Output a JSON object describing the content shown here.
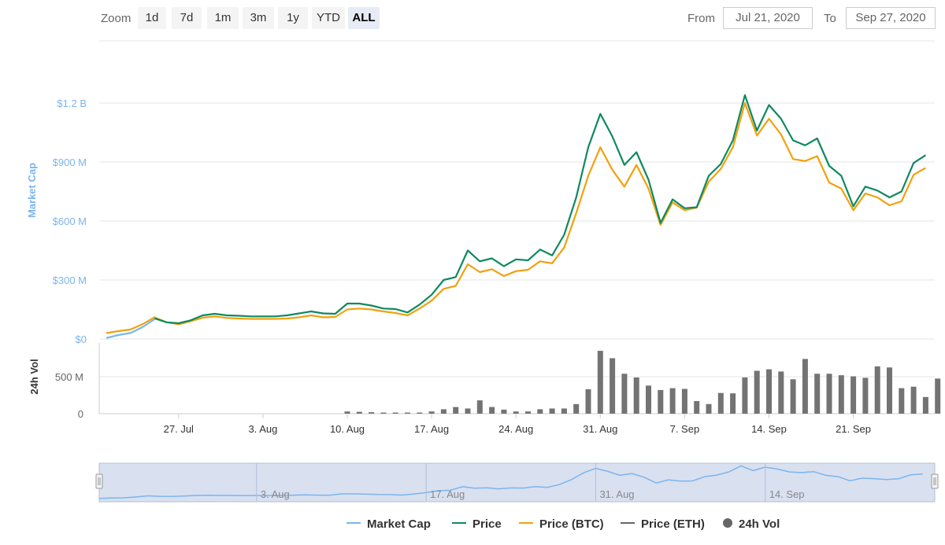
{
  "toolbar": {
    "zoom_label": "Zoom",
    "zoom_buttons": [
      "1d",
      "7d",
      "1m",
      "3m",
      "1y",
      "YTD",
      "ALL"
    ],
    "active_zoom": "ALL",
    "from_label": "From",
    "from_value": "Jul 21, 2020",
    "to_label": "To",
    "to_value": "Sep 27, 2020"
  },
  "colors": {
    "market_cap": "#7cb5ec",
    "price": "#0e8a5f",
    "price_btc": "#f1a10d",
    "price_eth": "#666666",
    "volume": "#737373",
    "navigator_fill": "#ccd6eb",
    "axis_blue": "#7cb5ec"
  },
  "chart_data": {
    "type": "line",
    "x_dates": [
      "2020-07-21",
      "2020-07-22",
      "2020-07-23",
      "2020-07-24",
      "2020-07-25",
      "2020-07-26",
      "2020-07-27",
      "2020-07-28",
      "2020-07-29",
      "2020-07-30",
      "2020-07-31",
      "2020-08-01",
      "2020-08-02",
      "2020-08-03",
      "2020-08-04",
      "2020-08-05",
      "2020-08-06",
      "2020-08-07",
      "2020-08-08",
      "2020-08-09",
      "2020-08-10",
      "2020-08-11",
      "2020-08-12",
      "2020-08-13",
      "2020-08-14",
      "2020-08-15",
      "2020-08-16",
      "2020-08-17",
      "2020-08-18",
      "2020-08-19",
      "2020-08-20",
      "2020-08-21",
      "2020-08-22",
      "2020-08-23",
      "2020-08-24",
      "2020-08-25",
      "2020-08-26",
      "2020-08-27",
      "2020-08-28",
      "2020-08-29",
      "2020-08-30",
      "2020-08-31",
      "2020-09-01",
      "2020-09-02",
      "2020-09-03",
      "2020-09-04",
      "2020-09-05",
      "2020-09-06",
      "2020-09-07",
      "2020-09-08",
      "2020-09-09",
      "2020-09-10",
      "2020-09-11",
      "2020-09-12",
      "2020-09-13",
      "2020-09-14",
      "2020-09-15",
      "2020-09-16",
      "2020-09-17",
      "2020-09-18",
      "2020-09-19",
      "2020-09-20",
      "2020-09-21",
      "2020-09-22",
      "2020-09-23",
      "2020-09-24",
      "2020-09-25",
      "2020-09-26",
      "2020-09-27",
      "2020-09-28"
    ],
    "x_ticks": [
      "27. Jul",
      "3. Aug",
      "10. Aug",
      "17. Aug",
      "24. Aug",
      "31. Aug",
      "7. Sep",
      "14. Sep",
      "21. Sep"
    ],
    "ylabel": "Market Cap",
    "y_ticks": [
      "$0",
      "$300 M",
      "$600 M",
      "$900 M",
      "$1.2 B"
    ],
    "ylim": [
      0,
      1200
    ],
    "y_unit": "M USD",
    "series": [
      {
        "name": "Market Cap",
        "color": "#7cb5ec",
        "start_index": 0,
        "values": [
          5,
          20,
          30,
          60,
          100
        ]
      },
      {
        "name": "Price",
        "color": "#0e8a5f",
        "start_index": 4,
        "values": [
          105,
          85,
          80,
          95,
          120,
          128,
          120,
          118,
          115,
          115,
          115,
          120,
          130,
          140,
          130,
          128,
          180,
          180,
          170,
          155,
          152,
          135,
          175,
          225,
          300,
          315,
          450,
          395,
          410,
          370,
          405,
          400,
          455,
          425,
          530,
          720,
          975,
          1145,
          1030,
          885,
          950,
          810,
          590,
          710,
          665,
          670,
          830,
          890,
          1010,
          1240,
          1060,
          1190,
          1120,
          1010,
          985,
          1020,
          880,
          830,
          675,
          775,
          755,
          720,
          750,
          895,
          935
        ]
      },
      {
        "name": "Price (BTC)",
        "color": "#f1a10d",
        "start_index": 0,
        "values": [
          30,
          40,
          48,
          75,
          110,
          85,
          75,
          90,
          108,
          115,
          107,
          104,
          102,
          102,
          102,
          104,
          110,
          120,
          110,
          112,
          150,
          155,
          150,
          140,
          132,
          120,
          155,
          195,
          255,
          270,
          380,
          340,
          355,
          320,
          345,
          352,
          395,
          385,
          465,
          640,
          830,
          975,
          860,
          775,
          885,
          765,
          580,
          695,
          655,
          668,
          800,
          865,
          975,
          1200,
          1035,
          1120,
          1040,
          915,
          905,
          930,
          795,
          765,
          655,
          740,
          720,
          680,
          700,
          835,
          870
        ]
      }
    ],
    "volume": {
      "ylabel": "24h Vol",
      "y_ticks": [
        "0",
        "500 M"
      ],
      "ylim": [
        0,
        900
      ],
      "y_unit": "M USD",
      "start_index": 20,
      "values": [
        30,
        25,
        20,
        15,
        15,
        15,
        15,
        30,
        60,
        90,
        70,
        180,
        90,
        55,
        30,
        30,
        60,
        70,
        70,
        130,
        330,
        850,
        750,
        540,
        490,
        380,
        320,
        345,
        335,
        170,
        130,
        280,
        275,
        490,
        580,
        600,
        570,
        465,
        740,
        540,
        540,
        520,
        505,
        485,
        640,
        625,
        345,
        365,
        225,
        475,
        560
      ]
    },
    "navigator_ticks": [
      "3. Aug",
      "17. Aug",
      "31. Aug",
      "14. Sep"
    ]
  },
  "legend": {
    "items": [
      {
        "label": "Market Cap",
        "color": "#7cb5ec",
        "icon": "line-swatch"
      },
      {
        "label": "Price",
        "color": "#0e8a5f",
        "icon": "line-swatch"
      },
      {
        "label": "Price (BTC)",
        "color": "#f1a10d",
        "icon": "line-swatch"
      },
      {
        "label": "Price (ETH)",
        "color": "#666666",
        "icon": "line-swatch"
      },
      {
        "label": "24h Vol",
        "color": "#666666",
        "icon": "dot-swatch"
      }
    ]
  }
}
